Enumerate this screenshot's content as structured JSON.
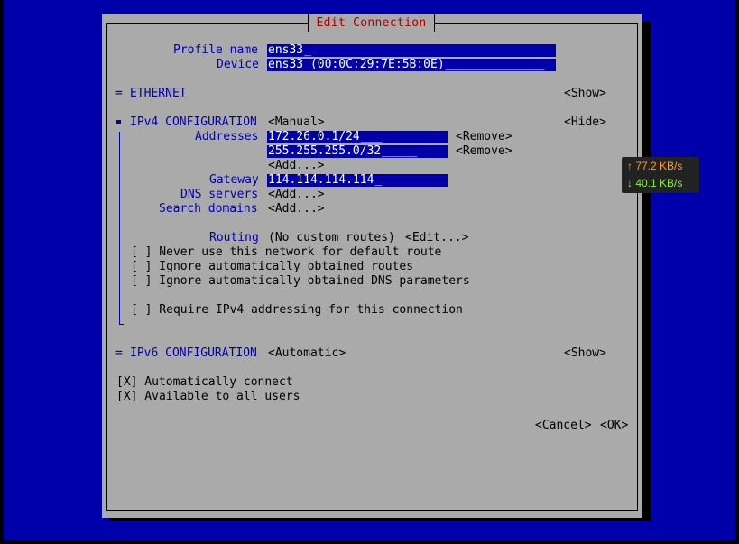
{
  "dialog": {
    "title": "Edit Connection"
  },
  "profile": {
    "name_label": "Profile name",
    "name_value": "ens33",
    "device_label": "Device",
    "device_value": "ens33 (00:0C:29:7E:5B:0E)"
  },
  "ethernet": {
    "marker": "=",
    "label": "ETHERNET",
    "toggle": "<Show>"
  },
  "ipv4": {
    "label": "IPv4 CONFIGURATION",
    "mode": "<Manual>",
    "toggle": "<Hide>",
    "addresses_label": "Addresses",
    "addresses": [
      "172.26.0.1/24",
      "255.255.255.0/32"
    ],
    "remove_label": "<Remove>",
    "add_label": "<Add...>",
    "gateway_label": "Gateway",
    "gateway_value": "114.114.114.114",
    "dns_label": "DNS servers",
    "search_label": "Search domains",
    "routing_label": "Routing",
    "routing_value": "(No custom routes)",
    "routing_edit": "<Edit...>",
    "checkboxes": [
      "[ ] Never use this network for default route",
      "[ ] Ignore automatically obtained routes",
      "[ ] Ignore automatically obtained DNS parameters"
    ],
    "require_checkbox": "[ ] Require IPv4 addressing for this connection"
  },
  "ipv6": {
    "marker": "=",
    "label": "IPv6 CONFIGURATION",
    "mode": "<Automatic>",
    "toggle": "<Show>"
  },
  "options": {
    "auto_connect": "[X] Automatically connect",
    "all_users": "[X] Available to all users"
  },
  "buttons": {
    "cancel": "<Cancel>",
    "ok": "<OK>"
  },
  "speed_widget": {
    "upload": "↑ 77.2 KB/s",
    "download": "↓ 40.1 KB/s"
  },
  "colors": {
    "background": "#0000aa",
    "dialog": "#aaaaaa",
    "title": "#aa0000",
    "field": "#0000aa"
  }
}
